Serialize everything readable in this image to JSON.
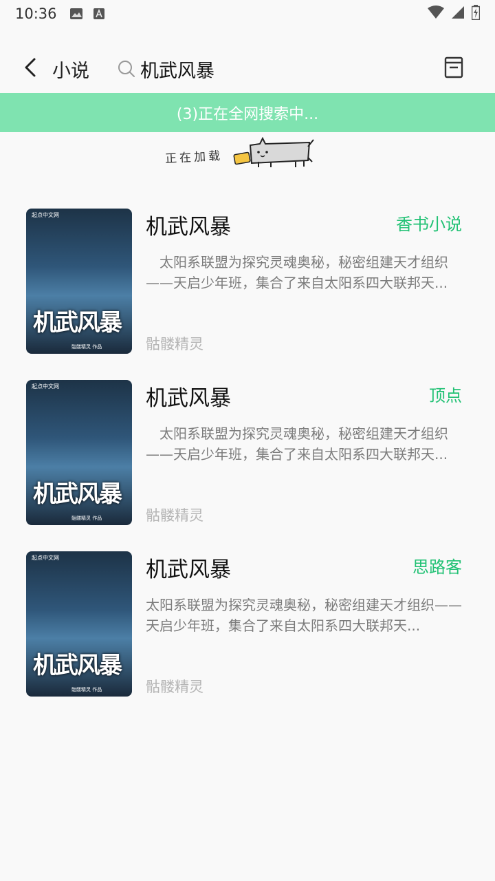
{
  "status_bar": {
    "time": "10:36",
    "icons": [
      "image-icon",
      "text-icon",
      "wifi-icon",
      "signal-icon",
      "battery-icon"
    ]
  },
  "app_bar": {
    "back_icon": "back-arrow-icon",
    "category": "小说",
    "search_value": "机武风暴",
    "bookshelf_icon": "bookshelf-icon"
  },
  "banner": {
    "text": "(3)正在全网搜索中..."
  },
  "loading": {
    "text": "正在加载"
  },
  "colors": {
    "accent": "#21c174",
    "banner": "#7fe3b0"
  },
  "results": [
    {
      "title": "机武风暴",
      "source": "香书小说",
      "desc": "　太阳系联盟为探究灵魂奥秘，秘密组建天才组织——天启少年班，集合了来自太阳系四大联邦天...",
      "author": "骷髅精灵",
      "cover": {
        "publisher": "起点中文网",
        "title": "机武风暴",
        "author_line": "骷髅精灵 作品"
      }
    },
    {
      "title": "机武风暴",
      "source": "顶点",
      "desc": "　太阳系联盟为探究灵魂奥秘，秘密组建天才组织——天启少年班，集合了来自太阳系四大联邦天...",
      "author": "骷髅精灵",
      "cover": {
        "publisher": "起点中文网",
        "title": "机武风暴",
        "author_line": "骷髅精灵 作品"
      }
    },
    {
      "title": "机武风暴",
      "source": "思路客",
      "desc": "太阳系联盟为探究灵魂奥秘，秘密组建天才组织——天启少年班，集合了来自太阳系四大联邦天...",
      "author": "骷髅精灵",
      "cover": {
        "publisher": "起点中文网",
        "title": "机武风暴",
        "author_line": "骷髅精灵 作品"
      }
    }
  ]
}
